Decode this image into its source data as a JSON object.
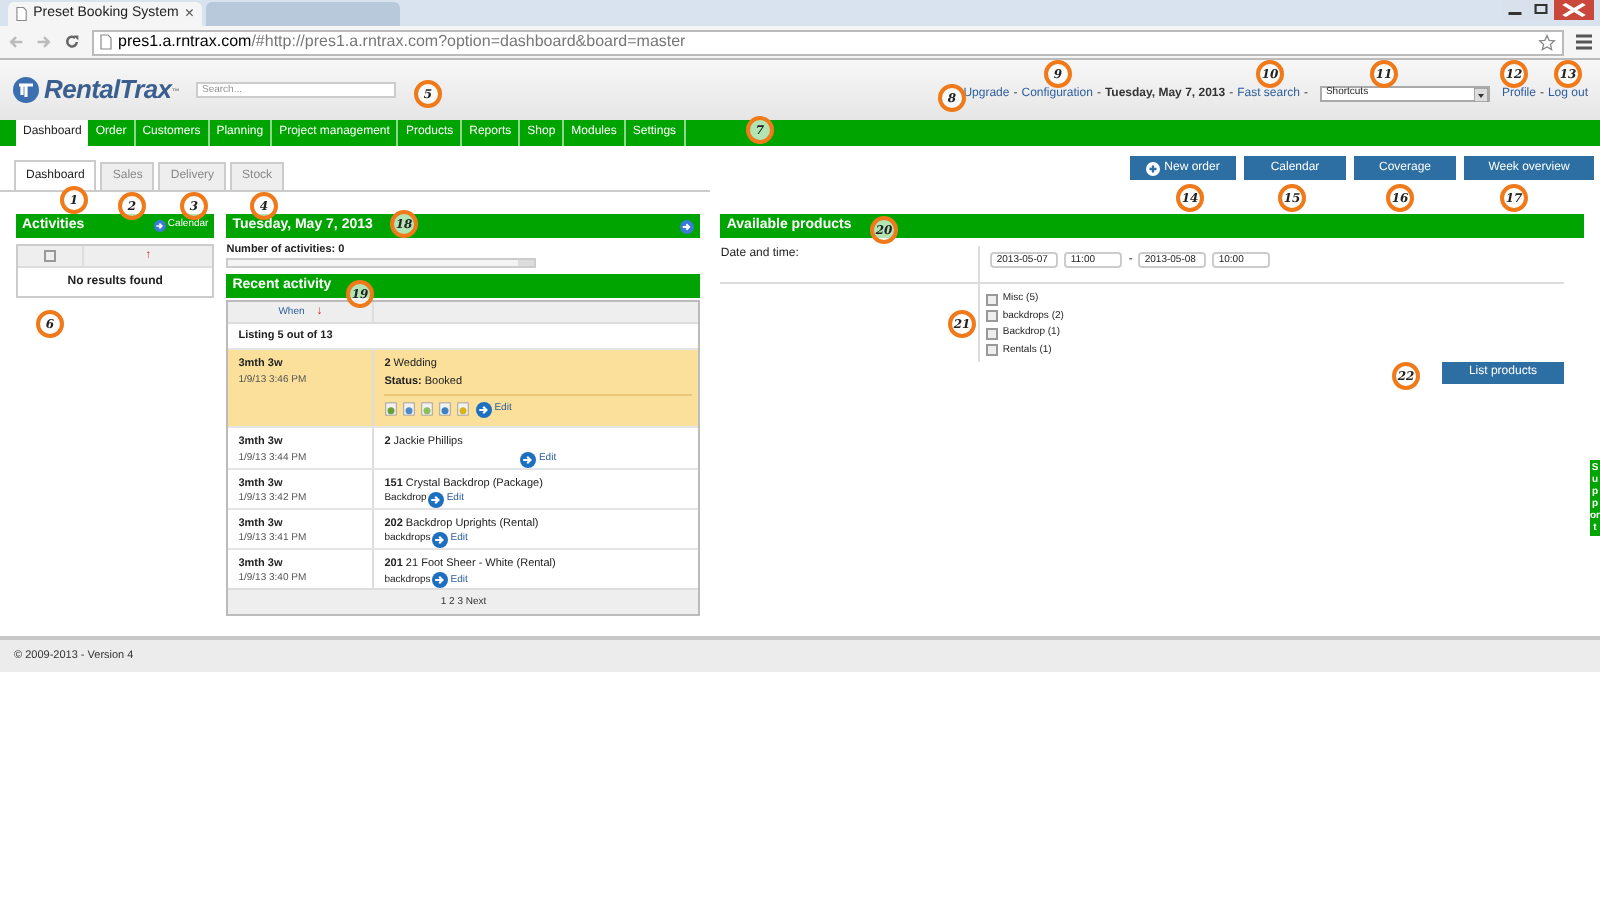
{
  "browser": {
    "tabs": [
      {
        "title": "Preset Booking System",
        "selected": true,
        "close": "×"
      },
      {
        "selected": false
      }
    ],
    "url_host": "pres1.a.rntrax.com",
    "url_rest": "/#http://pres1.a.rntrax.com?option=dashboard&board=master"
  },
  "header": {
    "logo": "RentalTrax",
    "logo_tm": "™",
    "search": {
      "placeholder": "Search..."
    },
    "links": [
      {
        "kind": "link",
        "text": "Upgrade"
      },
      {
        "kind": "sep",
        "text": "-"
      },
      {
        "kind": "link",
        "text": "Configuration"
      },
      {
        "kind": "sep",
        "text": "-"
      },
      {
        "kind": "date",
        "text": "Tuesday, May 7, 2013"
      },
      {
        "kind": "sep",
        "text": "-"
      },
      {
        "kind": "link",
        "text": "Fast search"
      },
      {
        "kind": "sep",
        "text": "-"
      },
      {
        "kind": "select",
        "text": "Shortcuts"
      },
      {
        "kind": "link",
        "text": "Profile"
      },
      {
        "kind": "sep",
        "text": "-"
      },
      {
        "kind": "link",
        "text": "Log out"
      }
    ]
  },
  "nav": [
    {
      "label": "Dashboard",
      "selected": true
    },
    {
      "label": "Order",
      "selected": false
    },
    {
      "label": "Customers",
      "selected": false
    },
    {
      "label": "Planning",
      "selected": false
    },
    {
      "label": "Project management",
      "selected": false
    },
    {
      "label": "Products",
      "selected": false
    },
    {
      "label": "Reports",
      "selected": false
    },
    {
      "label": "Shop",
      "selected": false
    },
    {
      "label": "Modules",
      "selected": false
    },
    {
      "label": "Settings",
      "selected": false
    }
  ],
  "subtabs": [
    {
      "label": "Dashboard",
      "selected": true
    },
    {
      "label": "Sales",
      "selected": false
    },
    {
      "label": "Delivery",
      "selected": false
    },
    {
      "label": "Stock",
      "selected": false
    }
  ],
  "actions": [
    "New order",
    "Calendar",
    "Coverage",
    "Week overview"
  ],
  "activities": {
    "title": "Activities",
    "calendar_link": "Calendar",
    "sort_mark": "↑",
    "checked": false,
    "empty": "No results found"
  },
  "day": {
    "title": "Tuesday, May 7, 2013",
    "count": "Number of activities: 0"
  },
  "recent": {
    "title": "Recent activity",
    "column_when": "When",
    "sort_mark": "↓",
    "listing": "Listing 5 out of 13",
    "pagination": "1 2 3 Next",
    "rows": [
      {
        "when": "3mth 3w",
        "time": "1/9/13 3:46 PM",
        "number": "2",
        "title": "Wedding",
        "status_label": "Status:",
        "status": "Booked",
        "edit": "Edit",
        "selected": true
      },
      {
        "when": "3mth 3w",
        "time": "1/9/13 3:44 PM",
        "number": "2",
        "title": "Jackie Phillips",
        "edit": "Edit",
        "selected": false
      },
      {
        "when": "3mth 3w",
        "time": "1/9/13 3:42 PM",
        "number": "151",
        "title": "Crystal Backdrop (Package)",
        "sub": "Backdrop",
        "edit": "Edit",
        "selected": false
      },
      {
        "when": "3mth 3w",
        "time": "1/9/13 3:41 PM",
        "number": "202",
        "title": "Backdrop Uprights (Rental)",
        "sub": "backdrops",
        "edit": "Edit",
        "selected": false
      },
      {
        "when": "3mth 3w",
        "time": "1/9/13 3:40 PM",
        "number": "201",
        "title": "21 Foot Sheer - White (Rental)",
        "sub": "backdrops",
        "edit": "Edit",
        "selected": false
      }
    ]
  },
  "available": {
    "title": "Available products",
    "date_label": "Date and time:",
    "from_date": "2013-05-07",
    "from_time": "11:00",
    "dash": "-",
    "to_date": "2013-05-08",
    "to_time": "10:00",
    "categories": [
      {
        "label": "Misc (5)",
        "checked": false
      },
      {
        "label": "backdrops (2)",
        "checked": false
      },
      {
        "label": "Backdrop (1)",
        "checked": false
      },
      {
        "label": "Rentals (1)",
        "checked": false
      }
    ],
    "button": "List products"
  },
  "support_tab": "Support",
  "footer": "© 2009-2013 - Version 4",
  "callouts": [
    "1",
    "2",
    "3",
    "4",
    "5",
    "6",
    "7",
    "8",
    "9",
    "10",
    "11",
    "12",
    "13",
    "14",
    "15",
    "16",
    "17",
    "18",
    "19",
    "20",
    "21",
    "22"
  ]
}
